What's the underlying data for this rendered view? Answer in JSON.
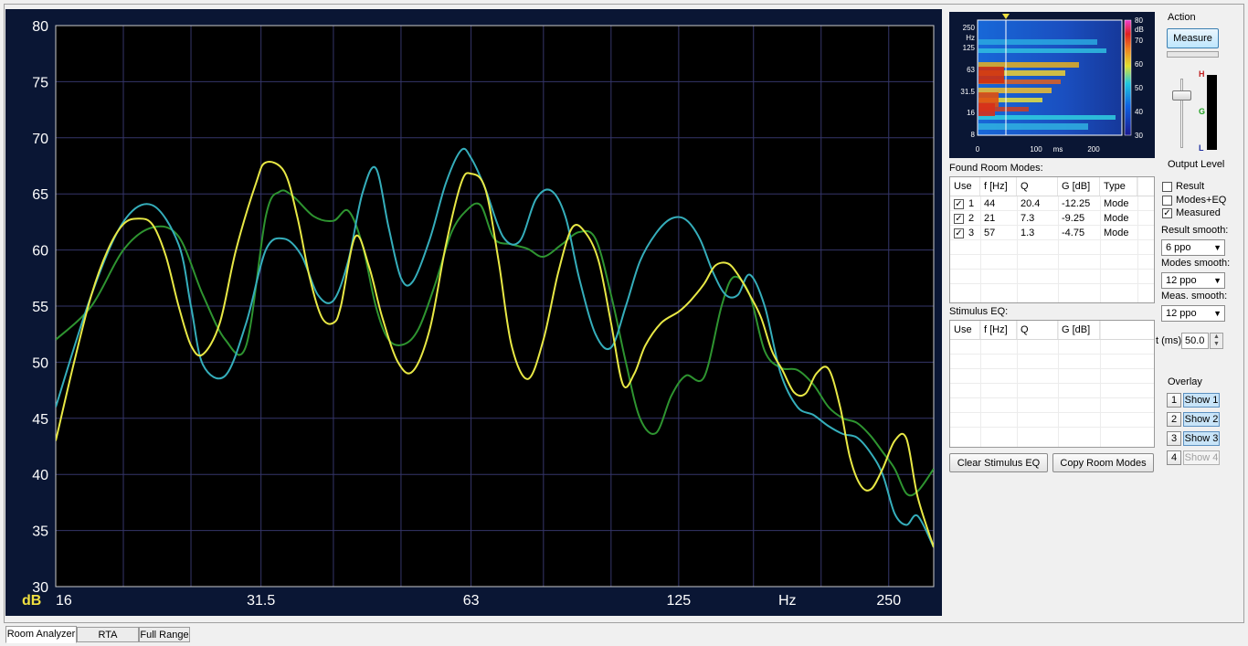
{
  "chart_data": {
    "type": "line",
    "ylabel": "dB",
    "xlabel": "Hz",
    "x_scale": "log",
    "xlim": [
      16,
      290
    ],
    "ylim": [
      30,
      80
    ],
    "y_ticks": [
      30,
      35,
      40,
      45,
      50,
      55,
      60,
      65,
      70,
      75,
      80
    ],
    "x_tick_labels": [
      {
        "value": 16,
        "label": "16"
      },
      {
        "value": 31.5,
        "label": "31.5"
      },
      {
        "value": 63,
        "label": "63"
      },
      {
        "value": 125,
        "label": "125"
      },
      {
        "value": 250,
        "label": "250"
      }
    ],
    "x_grid": [
      16,
      20,
      25,
      31.5,
      40,
      50,
      63,
      80,
      100,
      125,
      160,
      200,
      250
    ],
    "grid": true,
    "background": "#000000",
    "series": [
      {
        "color": "#e8e845",
        "x": [
          16,
          17,
          18,
          19,
          20,
          21,
          22,
          23,
          24,
          25,
          26,
          27.5,
          29,
          31,
          32,
          34,
          35.5,
          37,
          38.5,
          40,
          41,
          43,
          45,
          47,
          49.5,
          52,
          55,
          58,
          61,
          63,
          66,
          69,
          72,
          76,
          80,
          84,
          88,
          92,
          96,
          100,
          104,
          108,
          112,
          118,
          125,
          130,
          136,
          141,
          147,
          152,
          158,
          164,
          170,
          176,
          183,
          190,
          197,
          205,
          213,
          220,
          228,
          236,
          245,
          255,
          265,
          275,
          290
        ],
        "y": [
          43,
          50,
          56,
          60,
          62.3,
          62.8,
          62.3,
          59.5,
          55,
          51.5,
          50.7,
          53.5,
          60,
          66,
          67.8,
          67,
          63,
          57.5,
          54,
          53.5,
          55,
          61.2,
          58.5,
          54,
          50,
          49.2,
          53,
          60.5,
          66,
          66.8,
          65.5,
          59,
          51.5,
          48.5,
          52,
          58,
          62,
          61.5,
          59,
          53.5,
          48,
          49,
          51.5,
          53.5,
          54.5,
          55.5,
          57,
          58.6,
          58.8,
          57.8,
          56,
          54,
          51,
          49.3,
          47.3,
          47.2,
          49,
          49.4,
          46,
          41.5,
          39,
          38.7,
          40.5,
          43,
          43.2,
          38,
          33.5
        ]
      },
      {
        "color": "#2e9430",
        "x": [
          16,
          18,
          20,
          22,
          24,
          26,
          28,
          30,
          32,
          33.5,
          35,
          37.5,
          40,
          42,
          44,
          46,
          48,
          50.5,
          53,
          56,
          59,
          62,
          65,
          68,
          72,
          76,
          80,
          85,
          90,
          95,
          100,
          105,
          110,
          116,
          122,
          128,
          136,
          144,
          150,
          158,
          166,
          175,
          185,
          195,
          205,
          215,
          225,
          235,
          245,
          255,
          265,
          275,
          290
        ],
        "y": [
          52,
          55,
          60,
          62,
          61.2,
          56,
          52,
          51.5,
          63,
          65.2,
          64.8,
          63,
          62.6,
          63.5,
          60.5,
          55,
          52,
          51.6,
          53,
          57,
          61.5,
          63.5,
          64,
          61,
          60.5,
          60.1,
          59.4,
          60.5,
          61.6,
          61,
          56,
          50,
          45,
          43.7,
          47,
          48.8,
          48.7,
          55,
          57.6,
          56,
          51,
          49.5,
          49.3,
          48,
          46,
          45,
          44.6,
          43.5,
          42,
          40.5,
          38.3,
          38.5,
          40.5
        ]
      },
      {
        "color": "#35aebb",
        "x": [
          16,
          18,
          20,
          22,
          24,
          25,
          26,
          28,
          30,
          32,
          34,
          36,
          38,
          40,
          42,
          44,
          46,
          48,
          50,
          52,
          55,
          58,
          61,
          63,
          66,
          70,
          74,
          78,
          82,
          86,
          90,
          95,
          100,
          105,
          110,
          116,
          122,
          128,
          134,
          140,
          146,
          152,
          158,
          166,
          175,
          185,
          195,
          205,
          215,
          225,
          235,
          245,
          255,
          265,
          275,
          290
        ],
        "y": [
          46,
          56,
          62.5,
          64,
          60.5,
          55,
          49.8,
          48.8,
          53.5,
          60,
          61,
          59.5,
          56,
          55.5,
          59,
          65,
          67.3,
          62,
          57.5,
          57.2,
          61,
          66,
          68.9,
          68.2,
          65.5,
          61.2,
          60.8,
          64.5,
          65.3,
          63,
          57.5,
          52.5,
          51.3,
          55,
          59,
          61.5,
          62.8,
          62.7,
          61,
          58,
          56,
          56,
          57.8,
          55,
          49,
          46,
          45.3,
          44.3,
          43.6,
          43.3,
          42,
          40,
          36.5,
          35.5,
          36.3,
          33.5
        ]
      }
    ]
  },
  "waterfall": {
    "y_labels": [
      "250",
      "Hz",
      "125",
      "63",
      "31.5",
      "16",
      "8"
    ],
    "x_labels": [
      "0",
      "100",
      "ms",
      "200"
    ],
    "scale_labels": [
      "80",
      "dB",
      "70",
      "60",
      "50",
      "40",
      "30"
    ]
  },
  "action": {
    "title": "Action",
    "measure": "Measure",
    "output_level": "Output Level",
    "meter_h": "H",
    "meter_g": "G",
    "meter_l": "L"
  },
  "room_modes": {
    "title": "Found Room Modes:",
    "headers": [
      "Use",
      "f [Hz]",
      "Q",
      "G [dB]",
      "Type"
    ],
    "rows": [
      {
        "use": "1",
        "f": "44",
        "q": "20.4",
        "g": "-12.25",
        "type": "Mode"
      },
      {
        "use": "2",
        "f": "21",
        "q": "7.3",
        "g": "-9.25",
        "type": "Mode"
      },
      {
        "use": "3",
        "f": "57",
        "q": "1.3",
        "g": "-4.75",
        "type": "Mode"
      }
    ]
  },
  "stimulus": {
    "title": "Stimulus EQ:",
    "headers": [
      "Use",
      "f [Hz]",
      "Q",
      "G [dB]"
    ]
  },
  "buttons": {
    "clear": "Clear Stimulus EQ",
    "copy": "Copy Room Modes"
  },
  "options": {
    "result": "Result",
    "modes_eq": "Modes+EQ",
    "measured": "Measured",
    "result_smooth": "Result smooth:",
    "result_smooth_val": "6 ppo",
    "modes_smooth": "Modes smooth:",
    "modes_smooth_val": "12 ppo",
    "meas_smooth": "Meas. smooth:",
    "meas_smooth_val": "12 ppo",
    "t_label": "t (ms)",
    "t_val": "50.0"
  },
  "overlay": {
    "title": "Overlay",
    "items": [
      {
        "num": "1",
        "label": "Show 1"
      },
      {
        "num": "2",
        "label": "Show 2"
      },
      {
        "num": "3",
        "label": "Show 3"
      },
      {
        "num": "4",
        "label": "Show 4"
      }
    ]
  },
  "tabs": [
    "Room Analyzer",
    "RTA",
    "Full Range"
  ]
}
